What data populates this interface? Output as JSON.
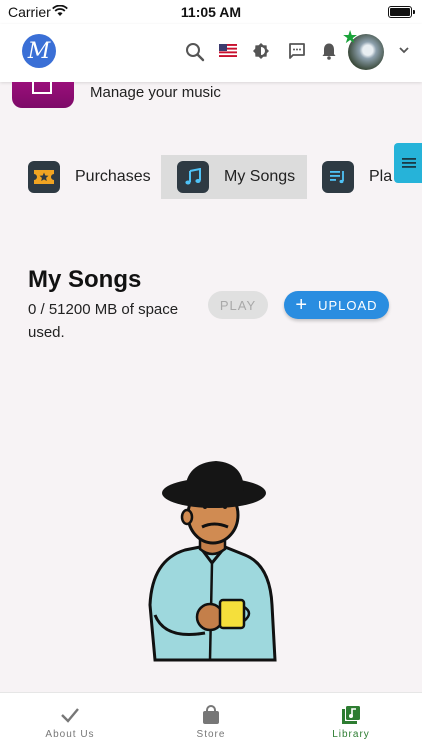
{
  "status_bar": {
    "carrier": "Carrier",
    "time": "11:05 AM"
  },
  "app_bar": {
    "logo_letter": "M",
    "icons": [
      "search-icon",
      "us-flag-icon",
      "brightness-icon",
      "chat-icon",
      "bell-icon",
      "avatar",
      "chevron-down-icon"
    ],
    "badge_color": "#1aa33a"
  },
  "promo": {
    "text": "Manage your music",
    "color": "#8b0c70"
  },
  "tabs": [
    {
      "label": "Purchases",
      "icon": "ticket-star-icon",
      "active": false
    },
    {
      "label": "My Songs",
      "icon": "music-note-icon",
      "active": true
    },
    {
      "label": "Pla",
      "icon": "playlist-icon",
      "active": false
    }
  ],
  "section": {
    "title": "My Songs",
    "usage": "0 / 51200 MB of space used.",
    "play_label": "PLAY",
    "upload_label": "UPLOAD"
  },
  "bottom_nav": [
    {
      "label": "About Us",
      "icon": "check-icon",
      "active": false
    },
    {
      "label": "Store",
      "icon": "shopping-bag-icon",
      "active": false
    },
    {
      "label": "Library",
      "icon": "library-music-icon",
      "active": true
    }
  ],
  "colors": {
    "accent": "#2a8de0",
    "teal": "#26b3d9",
    "active_nav": "#2e7d32"
  }
}
